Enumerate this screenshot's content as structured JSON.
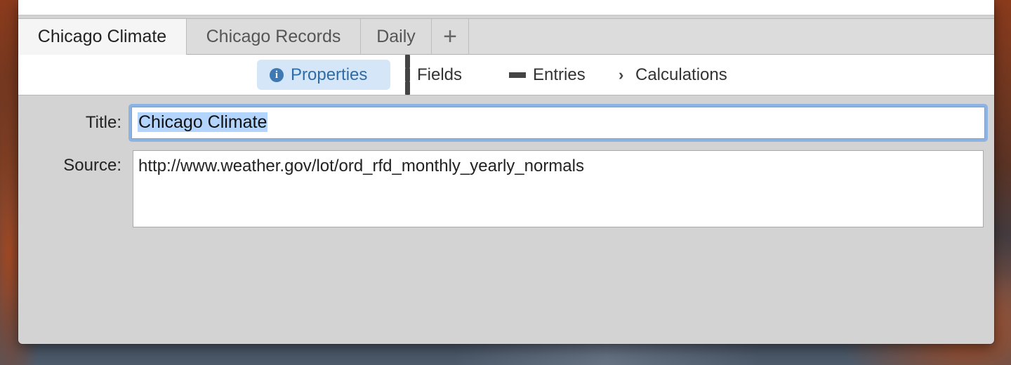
{
  "tabs": [
    {
      "label": "Chicago Climate",
      "active": true
    },
    {
      "label": "Chicago Records",
      "active": false
    },
    {
      "label": "Daily",
      "active": false
    },
    {
      "label": "+",
      "active": false
    }
  ],
  "toolbar": {
    "segments": [
      {
        "label": "Properties",
        "icon": "info-icon",
        "selected": true
      },
      {
        "label": "Fields",
        "icon": "columns-icon",
        "selected": false
      },
      {
        "label": "Entries",
        "icon": "list-icon",
        "selected": false
      },
      {
        "label": "Calculations",
        "icon": "chevron-right-icon",
        "selected": false
      }
    ],
    "selected_color": "#d4e6f8",
    "selected_text_color": "#2f6ca5"
  },
  "form": {
    "title_label": "Title:",
    "title_value": "Chicago Climate",
    "source_label": "Source:",
    "source_value": "http://www.weather.gov/lot/ord_rfd_monthly_yearly_normals"
  },
  "colors": {
    "focus_ring": "#8db3e2",
    "text_selection": "#b3d4fc",
    "window_background": "#d3d3d3"
  }
}
